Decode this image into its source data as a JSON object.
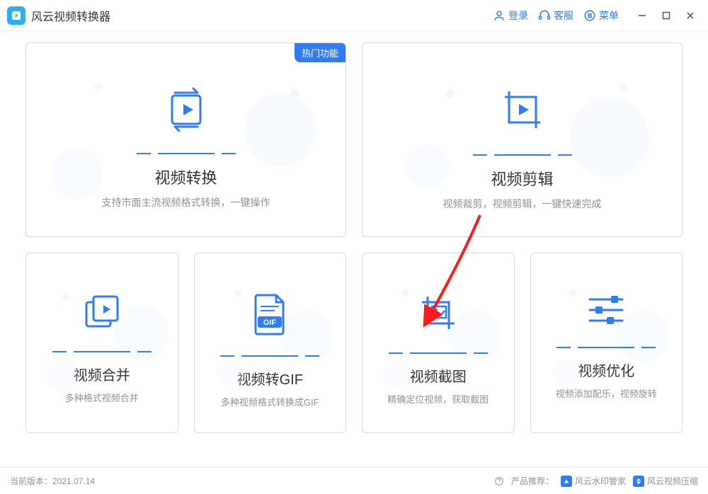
{
  "app": {
    "title": "风云视频转换器"
  },
  "header": {
    "login": "登录",
    "support": "客服",
    "menu": "菜单"
  },
  "badges": {
    "hot": "热门功能"
  },
  "cards": {
    "convert": {
      "title": "视频转换",
      "desc": "支持市面主流视频格式转换，一键操作"
    },
    "edit": {
      "title": "视频剪辑",
      "desc": "视频裁剪，视频剪辑，一键快速完成"
    },
    "merge": {
      "title": "视频合并",
      "desc": "多种格式视频合并"
    },
    "gif": {
      "title": "视频转GIF",
      "desc": "多种视频格式转换成GIF",
      "badge": "GIF"
    },
    "capture": {
      "title": "视频截图",
      "desc": "精确定位视频，获取截图"
    },
    "optimize": {
      "title": "视频优化",
      "desc": "视频添加配乐，视频旋转"
    }
  },
  "footer": {
    "versionLabel": "当前版本：",
    "version": "2021.07.14",
    "recommendLabel": "产品推荐：",
    "rec1": "风云水印管家",
    "rec2": "风云视频压缩"
  }
}
